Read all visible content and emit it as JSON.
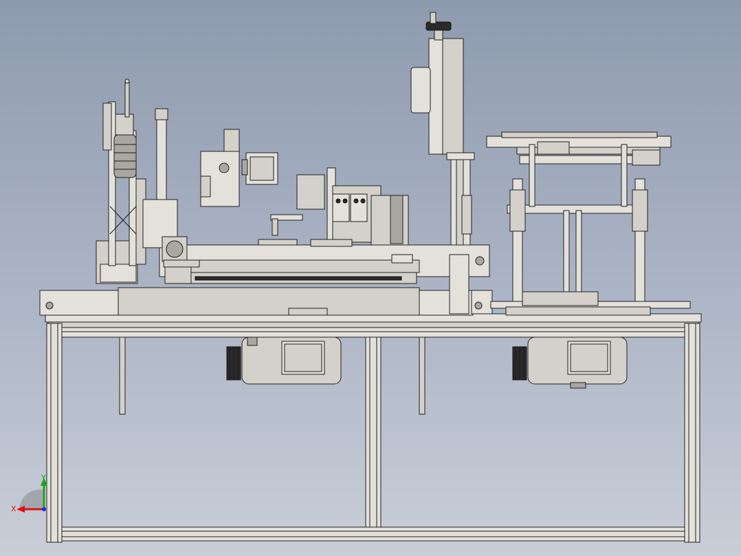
{
  "viewport": {
    "background_top": "#8e9aae",
    "background_bottom": "#c9ced8"
  },
  "model": {
    "description_icon": "machine-assembly-front-view"
  },
  "triad": {
    "x_label": "X",
    "y_label": "Y",
    "x_color": "#e01010",
    "y_color": "#1aa51a",
    "z_color": "#1a2fe0"
  }
}
